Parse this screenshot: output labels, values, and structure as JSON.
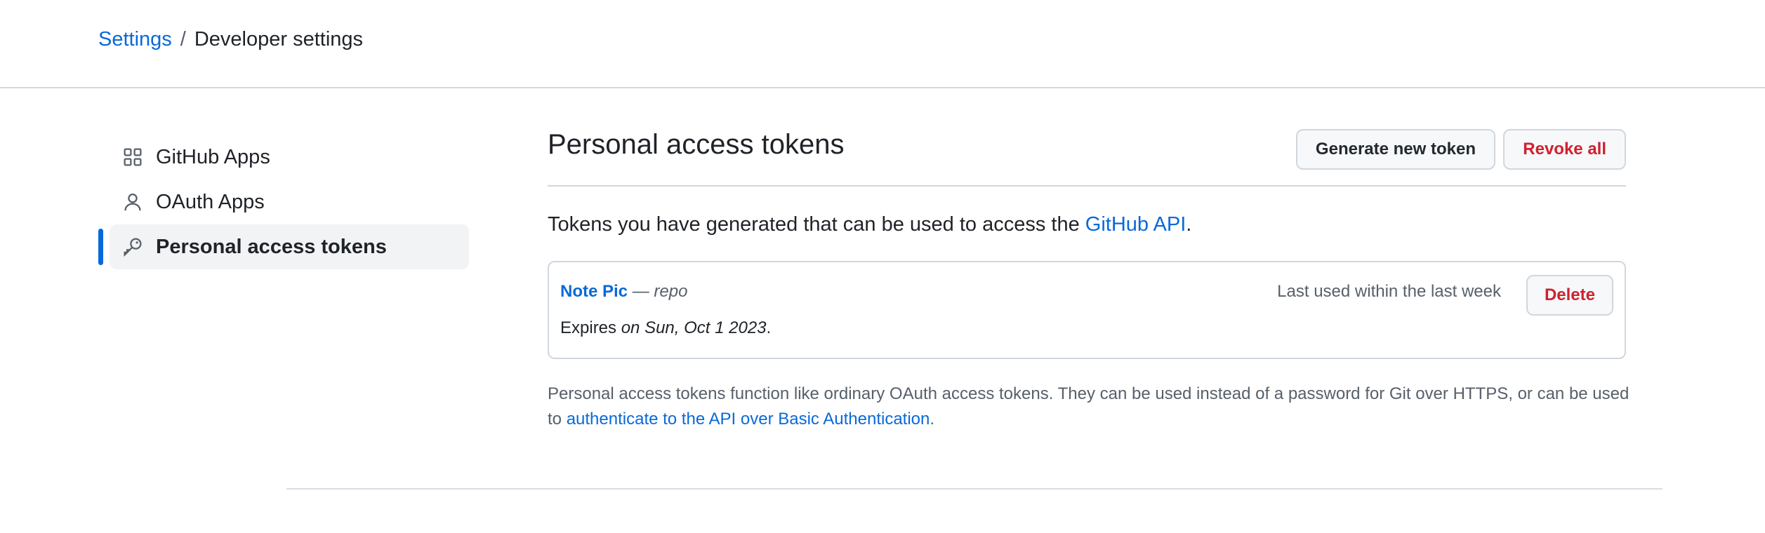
{
  "breadcrumb": {
    "parent": "Settings",
    "separator": "/",
    "current": "Developer settings"
  },
  "sidebar": {
    "items": [
      {
        "label": "GitHub Apps",
        "icon": "apps-grid-icon",
        "active": false
      },
      {
        "label": "OAuth Apps",
        "icon": "person-icon",
        "active": false
      },
      {
        "label": "Personal access tokens",
        "icon": "key-icon",
        "active": true
      }
    ]
  },
  "main": {
    "title": "Personal access tokens",
    "buttons": {
      "generate": "Generate new token",
      "revoke": "Revoke all"
    },
    "intro": {
      "text": "Tokens you have generated that can be used to access the ",
      "link": "GitHub API",
      "end": "."
    },
    "token": {
      "name": "Note Pic",
      "dash": " — ",
      "scope": "repo",
      "last_used": "Last used within the last week",
      "delete_label": "Delete",
      "expires_prefix": "Expires ",
      "expires_date": "on Sun, Oct 1 2023",
      "expires_end": "."
    },
    "note": {
      "text": "Personal access tokens function like ordinary OAuth access tokens. They can be used instead of a password for Git over HTTPS, or can be used to ",
      "link": "authenticate to the API over Basic Authentication",
      "end": "."
    }
  },
  "colors": {
    "accent": "#0969da",
    "danger": "#cf222e",
    "border": "#d0d7de",
    "muted": "#57606a"
  }
}
